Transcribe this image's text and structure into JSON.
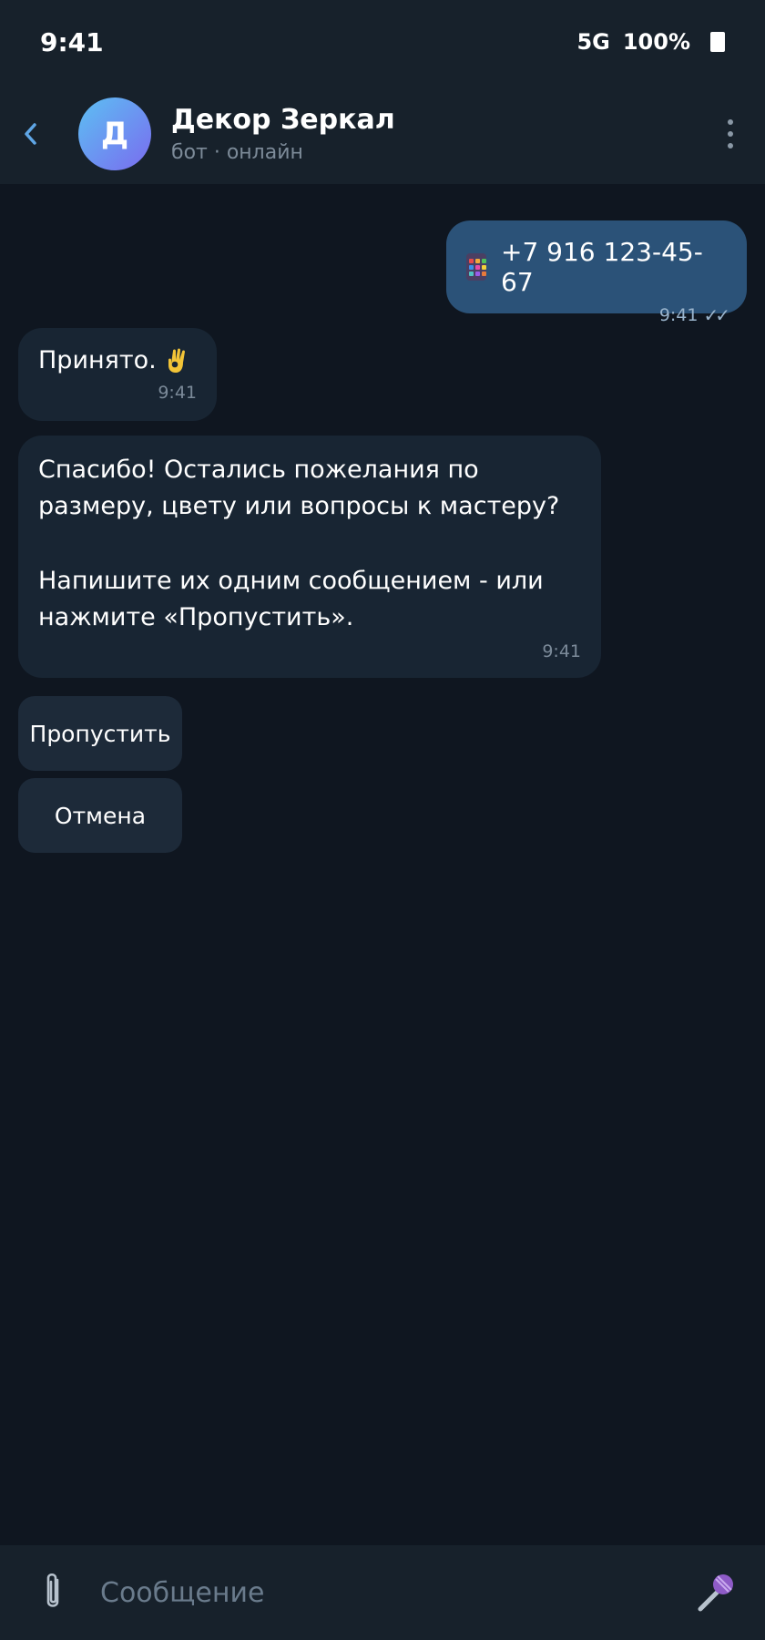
{
  "status_bar": {
    "time": "9:41",
    "network": "5G",
    "battery": "100%"
  },
  "header": {
    "back_icon": "chevron-left-icon",
    "avatar_letter": "Д",
    "title": "Декор Зеркал",
    "subtitle": "бот · онлайн",
    "menu_icon": "vertical-dots-icon"
  },
  "messages": [
    {
      "direction": "out",
      "icon": "mobile-phone-icon",
      "text": "+7 916 123-45-67",
      "time": "9:41",
      "status_icon": "double-check-icon",
      "status_text": "✓✓"
    },
    {
      "direction": "in",
      "text": "Принято.",
      "emoji_icon": "ok-hand-icon",
      "time": "9:41"
    },
    {
      "direction": "in",
      "paragraph1": "Спасибо! Остались пожелания по размеру, цвету или вопросы к мастеру?",
      "paragraph2": "Напишите их одним сообщением - или нажмите «Пропустить».",
      "time": "9:41"
    }
  ],
  "keyboard": {
    "buttons": [
      {
        "label": "Пропустить"
      },
      {
        "label": "Отмена"
      }
    ]
  },
  "composer": {
    "placeholder": "Сообщение",
    "value": "",
    "attach_icon": "paperclip-icon",
    "mic_icon": "microphone-icon"
  },
  "colors": {
    "background": "#0f1620",
    "header": "#17212b",
    "outgoing_bubble": "#2b5278",
    "incoming_bubble": "#182533",
    "keyboard_button": "#1d2a39",
    "accent": "#5fa6e6"
  }
}
